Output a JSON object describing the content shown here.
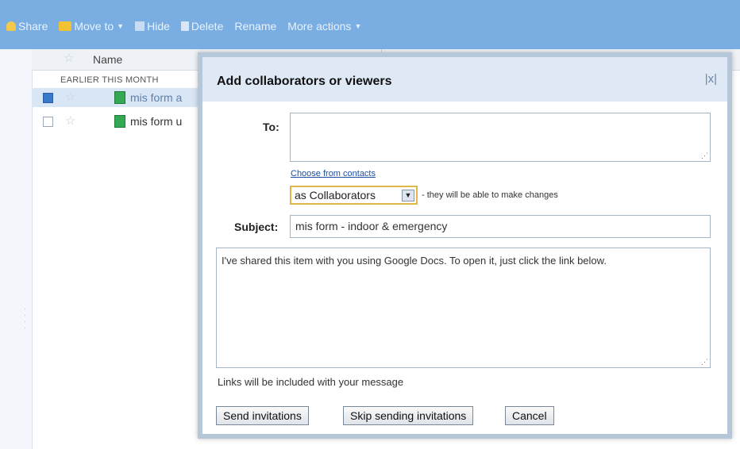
{
  "toolbar": {
    "share": "Share",
    "move_to": "Move to",
    "hide": "Hide",
    "delete": "Delete",
    "rename": "Rename",
    "more_actions": "More actions",
    "bg_color": "#7aaee3"
  },
  "list": {
    "column_name": "Name",
    "section_label": "EARLIER THIS MONTH",
    "rows": [
      {
        "title": "mis form a",
        "selected": true
      },
      {
        "title": "mis form u",
        "selected": false
      }
    ]
  },
  "dialog": {
    "title": "Add collaborators or viewers",
    "close_label": "|x|",
    "to_label": "To:",
    "to_value": "",
    "choose_link": "Choose from contacts",
    "role_value": "as Collaborators",
    "role_hint": "- they will be able to make changes",
    "subject_label": "Subject:",
    "subject_value": "mis form - indoor & emergency",
    "message": "I've shared this item with you using Google Docs. To open it, just click the link below.",
    "links_note": "Links will be included with your message",
    "send_button": "Send invitations",
    "skip_button": "Skip sending invitations",
    "cancel_button": "Cancel"
  }
}
